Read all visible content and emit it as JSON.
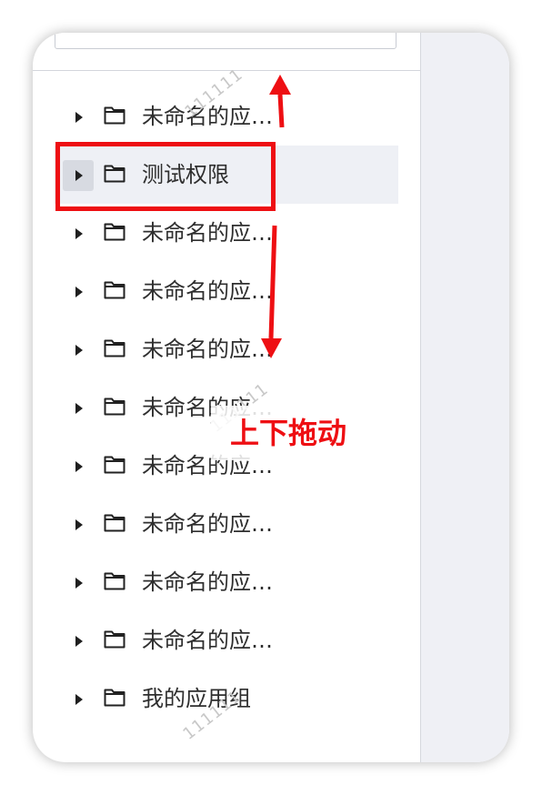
{
  "tree": {
    "nodes": [
      {
        "label": "未命名的应…",
        "selected": false
      },
      {
        "label": "测试权限",
        "selected": true
      },
      {
        "label": "未命名的应…",
        "selected": false
      },
      {
        "label": "未命名的应…",
        "selected": false
      },
      {
        "label": "未命名的应…",
        "selected": false
      },
      {
        "label": "未命名的应…",
        "selected": false
      },
      {
        "label": "未命名的应…",
        "selected": false
      },
      {
        "label": "未命名的应…",
        "selected": false
      },
      {
        "label": "未命名的应…",
        "selected": false
      },
      {
        "label": "未命名的应…",
        "selected": false
      },
      {
        "label": "我的应用组",
        "selected": false
      }
    ]
  },
  "watermark": {
    "text": "111111"
  },
  "annotation": {
    "label": "上下拖动",
    "color": "#ee0f13"
  },
  "icons": {
    "expand": "caret-right-icon",
    "folder": "folder-icon"
  },
  "colors": {
    "selected_bg": "#eef0f5",
    "right_panel_bg": "#eff0f5"
  }
}
